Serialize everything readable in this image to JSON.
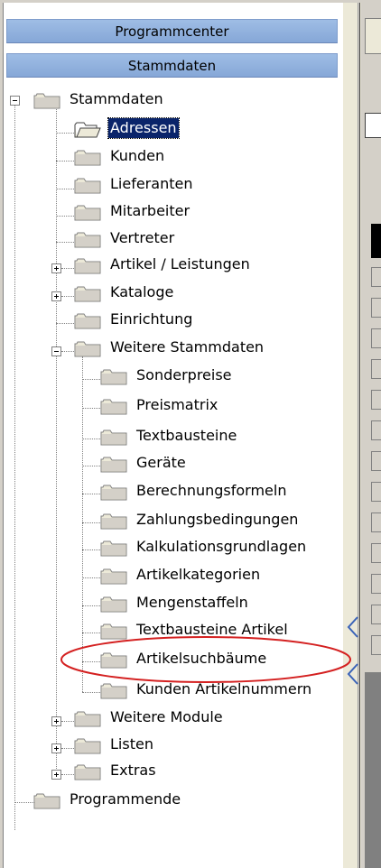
{
  "nav": {
    "programmcenter": "Programmcenter",
    "stammdaten": "Stammdaten"
  },
  "tree": {
    "root": "Stammdaten",
    "items": [
      "Adressen",
      "Kunden",
      "Lieferanten",
      "Mitarbeiter",
      "Vertreter",
      "Artikel / Leistungen",
      "Kataloge",
      "Einrichtung",
      "Weitere Stammdaten",
      "Weitere Module",
      "Listen",
      "Extras",
      "Programmende"
    ],
    "weitere_stammdaten_children": [
      "Sonderpreise",
      "Preismatrix",
      "Textbausteine",
      "Geräte",
      "Berechnungsformeln",
      "Zahlungsbedingungen",
      "Kalkulationsgrundlagen",
      "Artikelkategorien",
      "Mengenstaffeln",
      "Textbausteine Artikel",
      "Artikelsuchbäume",
      "Kunden Artikelnummern"
    ],
    "selected": "Adressen",
    "highlighted": "Artikelsuchbäume"
  },
  "colors": {
    "nav_button": "#9fbde5",
    "selection": "#0a246a",
    "highlight_ellipse": "#d42020"
  }
}
